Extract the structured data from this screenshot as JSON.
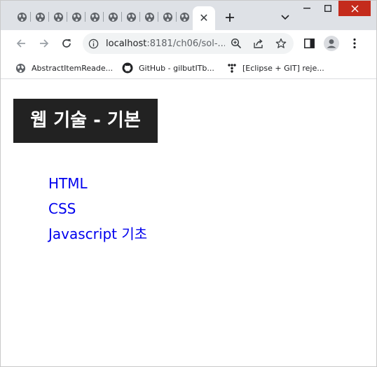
{
  "browser": {
    "active_tab_close": "✕",
    "new_tab": "+",
    "address": {
      "host": "localhost",
      "rest": ":8181/ch06/sol-..."
    },
    "bookmarks": [
      {
        "label": "AbstractItemReade...",
        "icon": "globe-icon"
      },
      {
        "label": "GitHub - gilbutITb...",
        "icon": "github-icon"
      },
      {
        "label": "[Eclipse + GIT] reje...",
        "icon": "tistory-icon"
      }
    ]
  },
  "page": {
    "title": "웹 기술 - 기본",
    "links": [
      {
        "label": "HTML"
      },
      {
        "label": "CSS"
      },
      {
        "label": "Javascript 기초"
      }
    ],
    "link_color": "#0000ee",
    "title_bg": "#222222"
  }
}
